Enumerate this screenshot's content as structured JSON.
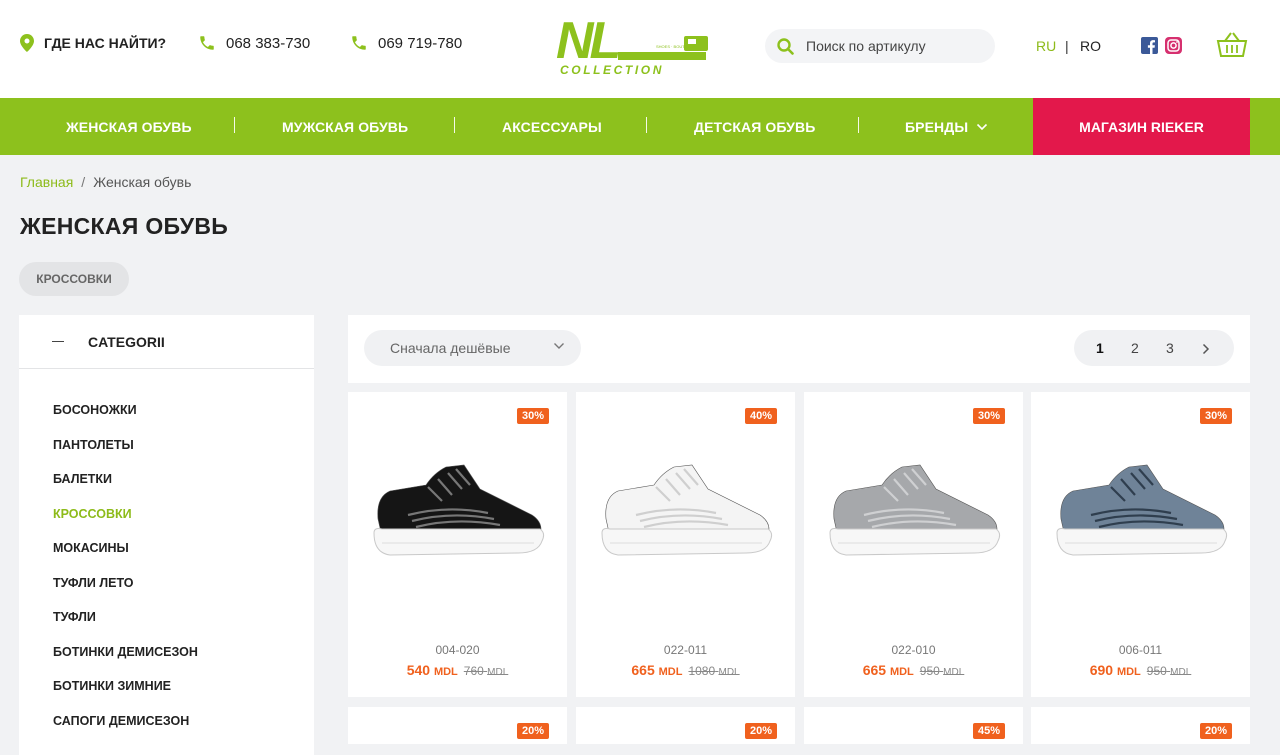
{
  "header": {
    "find_label": "ГДЕ НАС НАЙТИ?",
    "phone1": "068 383-730",
    "phone2": "069 719-780",
    "logo_main": "NL",
    "logo_sub": "COLLECTION",
    "logo_tag": "SHOES · BOUTIQUE",
    "search_placeholder": "Поиск по артикулу",
    "lang_ru": "RU",
    "lang_sep": "|",
    "lang_ro": "RO"
  },
  "nav": {
    "items": [
      "ЖЕНСКАЯ ОБУВЬ",
      "МУЖСКАЯ ОБУВЬ",
      "АКСЕССУАРЫ",
      "ДЕТСКАЯ ОБУВЬ",
      "БРЕНДЫ"
    ],
    "rieker": "МАГАЗИН RIEKER"
  },
  "breadcrumb": {
    "home": "Главная",
    "sep": "/",
    "current": "Женская обувь"
  },
  "page_title": "ЖЕНСКАЯ ОБУВЬ",
  "chip": "КРОССОВКИ",
  "sidebar": {
    "title": "CATEGORII",
    "items": [
      "БОСОНОЖКИ",
      "ПАНТОЛЕТЫ",
      "БАЛЕТКИ",
      "КРОССОВКИ",
      "МОКАСИНЫ",
      "ТУФЛИ ЛЕТО",
      "ТУФЛИ",
      "БОТИНКИ ДЕМИСЕЗОН",
      "БОТИНКИ ЗИМНИЕ",
      "САПОГИ ДЕМИСЕЗОН"
    ],
    "active_index": 3
  },
  "toolbar": {
    "sort_label": "Сначала дешёвые",
    "pages": [
      "1",
      "2",
      "3"
    ],
    "current_page": "1"
  },
  "currency": "MDL",
  "products": [
    {
      "badge": "30%",
      "sku": "004-020",
      "price": "540",
      "old_price": "760",
      "color": "#151515",
      "accent": "#777777"
    },
    {
      "badge": "40%",
      "sku": "022-011",
      "price": "665",
      "old_price": "1080",
      "color": "#f4f4f4",
      "accent": "#cfcfcf"
    },
    {
      "badge": "30%",
      "sku": "022-010",
      "price": "665",
      "old_price": "950",
      "color": "#a6a8ab",
      "accent": "#cfd0d2"
    },
    {
      "badge": "30%",
      "sku": "006-011",
      "price": "690",
      "old_price": "950",
      "color": "#6f8398",
      "accent": "#2f3e4e"
    }
  ],
  "next_row_badges": [
    "20%",
    "20%",
    "45%",
    "20%"
  ],
  "colors": {
    "accent_green": "#8dc11d",
    "rieker_red": "#e3184b",
    "badge_orange": "#f0611e"
  }
}
